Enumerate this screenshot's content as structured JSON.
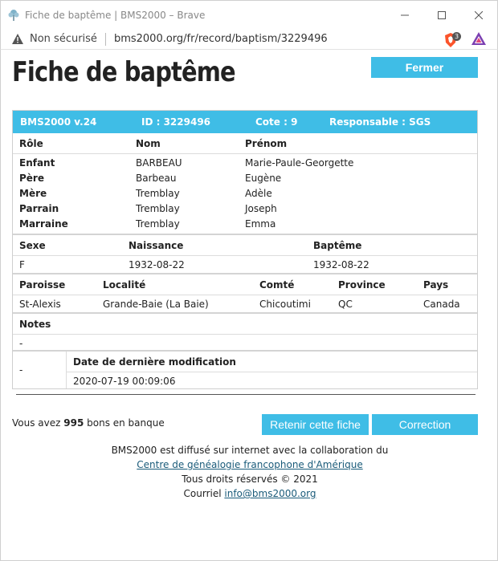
{
  "window": {
    "title": "Fiche de baptême | BMS2000 – Brave",
    "insecure_label": "Non sécurisé",
    "url": "bms2000.org/fr/record/baptism/3229496",
    "ext_badge": "3"
  },
  "page": {
    "title": "Fiche de baptême",
    "close_label": "Fermer"
  },
  "record": {
    "version": "BMS2000 v.24",
    "id": "ID : 3229496",
    "cote": "Cote : 9",
    "responsable": "Responsable : SGS",
    "people_headers": [
      "Rôle",
      "Nom",
      "Prénom"
    ],
    "people": [
      {
        "role": "Enfant",
        "nom": "BARBEAU",
        "prenom": "Marie-Paule-Georgette"
      },
      {
        "role": "Père",
        "nom": "Barbeau",
        "prenom": "Eugène"
      },
      {
        "role": "Mère",
        "nom": "Tremblay",
        "prenom": "Adèle"
      },
      {
        "role": "Parrain",
        "nom": "Tremblay",
        "prenom": "Joseph"
      },
      {
        "role": "Marraine",
        "nom": "Tremblay",
        "prenom": "Emma"
      }
    ],
    "event_headers": [
      "Sexe",
      "Naissance",
      "Baptême"
    ],
    "event": {
      "sexe": "F",
      "naissance": "1932-08-22",
      "bapteme": "1932-08-22"
    },
    "place_headers": [
      "Paroisse",
      "Localité",
      "Comté",
      "Province",
      "Pays"
    ],
    "place": {
      "paroisse": "St-Alexis",
      "localite": "Grande-Baie (La Baie)",
      "comte": "Chicoutimi",
      "province": "QC",
      "pays": "Canada"
    },
    "notes_header": "Notes",
    "notes": "-",
    "modif_left": "-",
    "modif_header": "Date de dernière modification",
    "modif_value": "2020-07-19 00:09:06"
  },
  "bank": {
    "prefix": "Vous avez ",
    "count": "995",
    "suffix": " bons en banque"
  },
  "actions": {
    "keep_label": "Retenir cette fiche",
    "fix_label": "Correction"
  },
  "footer": {
    "line1": "BMS2000 est diffusé sur internet avec la collaboration du",
    "link1": "Centre de généalogie francophone d'Amérique",
    "line3": "Tous droits réservés © 2021",
    "courriel_label": "Courriel ",
    "email": "info@bms2000.org"
  },
  "colors": {
    "accent": "#3fbde6",
    "brave_orange": "#fb542b",
    "link": "#1a5b7a"
  }
}
